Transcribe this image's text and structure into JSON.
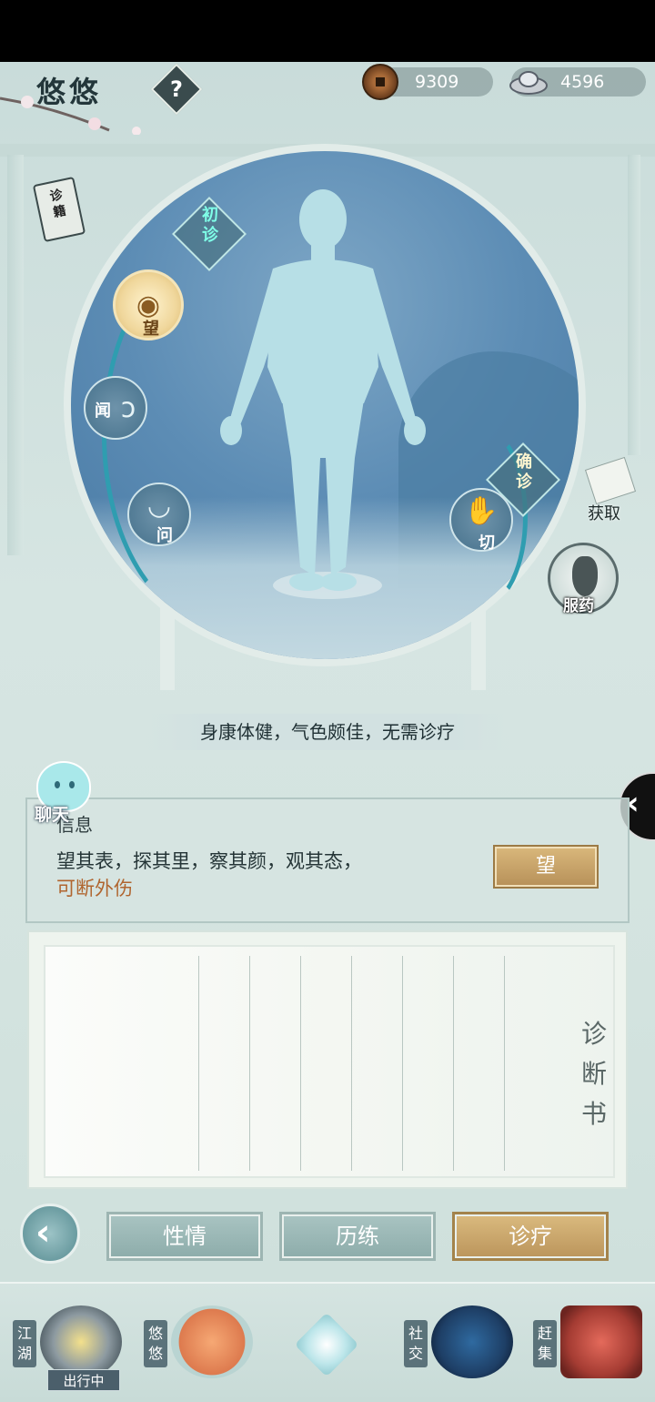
{
  "header": {
    "player_name": "悠悠",
    "help_label": "?",
    "copper_coins": "9309",
    "silver": "4596"
  },
  "side": {
    "book_label": "诊籍",
    "obtain_label": "获取",
    "medicine_label": "服药",
    "collapse_label": "‹"
  },
  "diagnosis": {
    "initial_label": "初诊",
    "confirm_label": "确诊",
    "methods": {
      "look": "望",
      "listen": "闻",
      "ask": "问",
      "pulse": "切"
    },
    "status_text": "身康体健，气色颇佳，无需诊疗"
  },
  "chat": {
    "label": "聊天"
  },
  "info": {
    "title": "信息",
    "line1": "望其表，探其里，察其颜，观其态，",
    "line2": "可断外伤",
    "action_label": "望"
  },
  "scroll": {
    "title": "诊断书"
  },
  "tabs": {
    "temper": "性情",
    "training": "历练",
    "treatment": "诊疗",
    "active": "诊疗"
  },
  "bottom_nav": {
    "jianghu": "江湖",
    "youyou": "悠悠",
    "social": "社交",
    "market": "赶集",
    "traveling_badge": "出行中"
  },
  "colors": {
    "accent_gold": "#c9a56a",
    "teal_tab": "#9bb8b6",
    "highlight_green": "#7fffe8",
    "info_orange": "#b0652f"
  }
}
